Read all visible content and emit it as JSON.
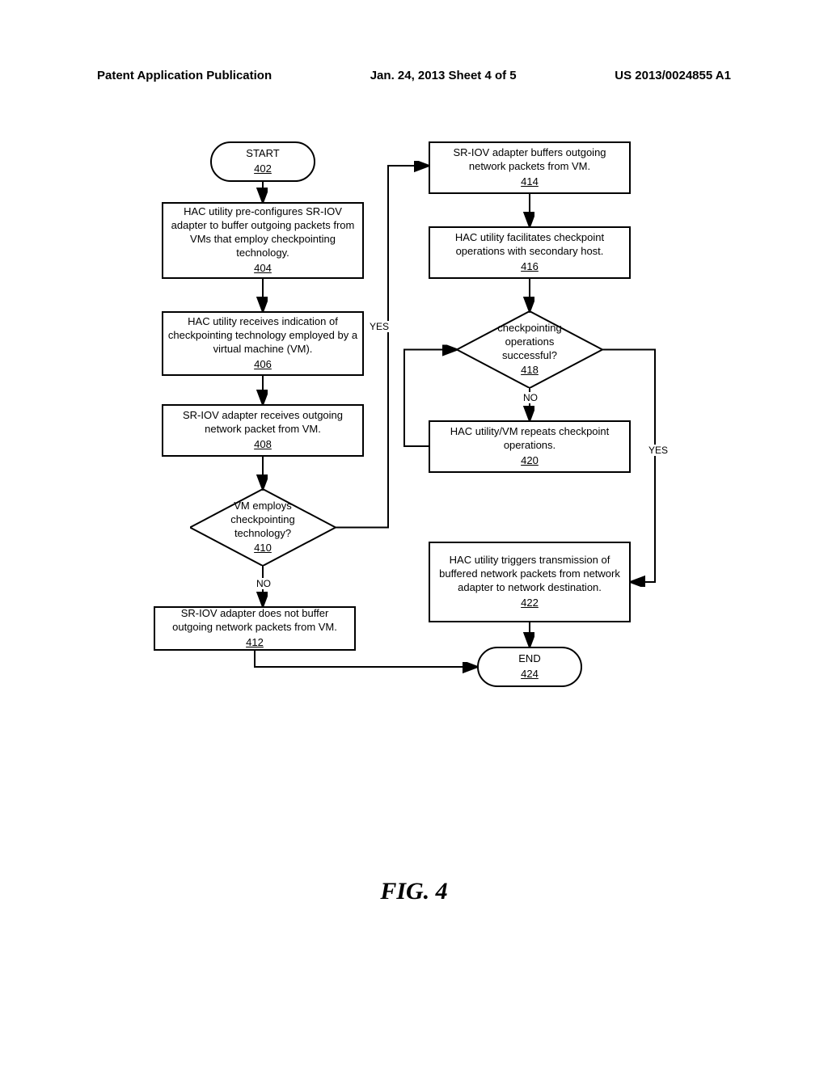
{
  "header": {
    "left": "Patent Application Publication",
    "center": "Jan. 24, 2013  Sheet 4 of 5",
    "right": "US 2013/0024855 A1"
  },
  "boxes": {
    "start": {
      "text": "START",
      "ref": "402"
    },
    "preconfig": {
      "text": "HAC utility pre-configures SR-IOV adapter to buffer outgoing packets from VMs that employ checkpointing technology.",
      "ref": "404"
    },
    "receives": {
      "text": "HAC utility receives indication of checkpointing technology employed by a virtual machine (VM).",
      "ref": "406"
    },
    "sendpacket": {
      "text": "SR-IOV adapter receives outgoing network packet from VM.",
      "ref": "408"
    },
    "employs": {
      "text": "VM employs checkpointing technology?",
      "ref": "410"
    },
    "notbuffer": {
      "text": "SR-IOV adapter does not buffer outgoing network packets from VM.",
      "ref": "412"
    },
    "buffers": {
      "text": "SR-IOV adapter buffers outgoing network packets from VM.",
      "ref": "414"
    },
    "facilitates": {
      "text": "HAC utility facilitates checkpoint operations with secondary host.",
      "ref": "416"
    },
    "success": {
      "text": "checkpointing operations successful?",
      "ref": "418"
    },
    "repeats": {
      "text": "HAC utility/VM repeats checkpoint operations.",
      "ref": "420"
    },
    "triggers": {
      "text": "HAC utility triggers transmission of buffered network packets from network adapter to network destination.",
      "ref": "422"
    },
    "end": {
      "text": "END",
      "ref": "424"
    }
  },
  "labels": {
    "yes": "YES",
    "no": "NO"
  },
  "figure": "FIG. 4"
}
